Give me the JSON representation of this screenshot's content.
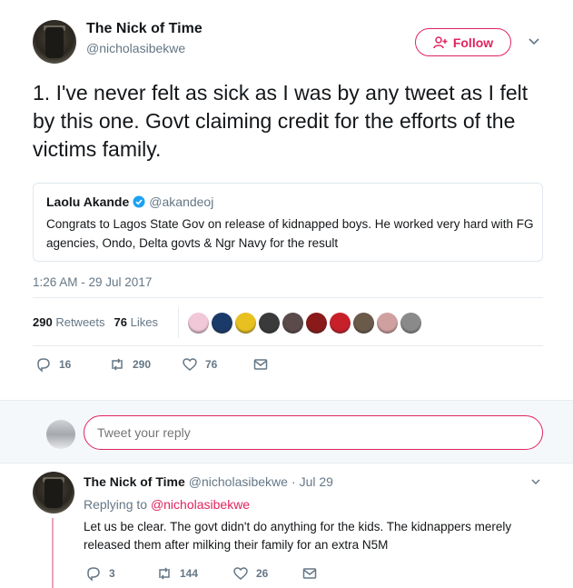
{
  "main_tweet": {
    "author_name": "The Nick of Time",
    "author_handle": "@nicholasibekwe",
    "follow_label": "Follow",
    "text": "1. I've never felt as sick as I was by any tweet as I felt by this one. Govt claiming credit for the efforts of the victims family.",
    "quoted": {
      "name": "Laolu Akande",
      "handle": "@akandeoj",
      "text": "Congrats to Lagos State Gov on release of kidnapped boys. He worked very hard with FG agencies, Ondo, Delta govts & Ngr Navy for  the result"
    },
    "timestamp": "1:26 AM - 29 Jul 2017",
    "retweets_count": "290",
    "retweets_label": "Retweets",
    "likes_count": "76",
    "likes_label": "Likes",
    "actions": {
      "replies": "16",
      "retweets": "290",
      "likes": "76"
    }
  },
  "reply_box": {
    "placeholder": "Tweet your reply"
  },
  "reply_tweet": {
    "author_name": "The Nick of Time",
    "author_handle": "@nicholasibekwe",
    "date": "Jul 29",
    "replying_prefix": "Replying to",
    "replying_to": "@nicholasibekwe",
    "text": "Let us be clear. The govt didn't do anything for the kids. The kidnappers merely released them after milking their family for an extra N5M",
    "actions": {
      "replies": "3",
      "retweets": "144",
      "likes": "26"
    }
  },
  "colors": {
    "accent": "#e0245e",
    "muted": "#657786",
    "verified": "#1da1f2"
  },
  "likers": [
    "#f0c8d8",
    "#1a3a6a",
    "#e8c020",
    "#3a3a3a",
    "#5a4a4a",
    "#8a1a1a",
    "#c8202a",
    "#6a5a4a",
    "#d0a0a0",
    "#8a8a8a"
  ]
}
